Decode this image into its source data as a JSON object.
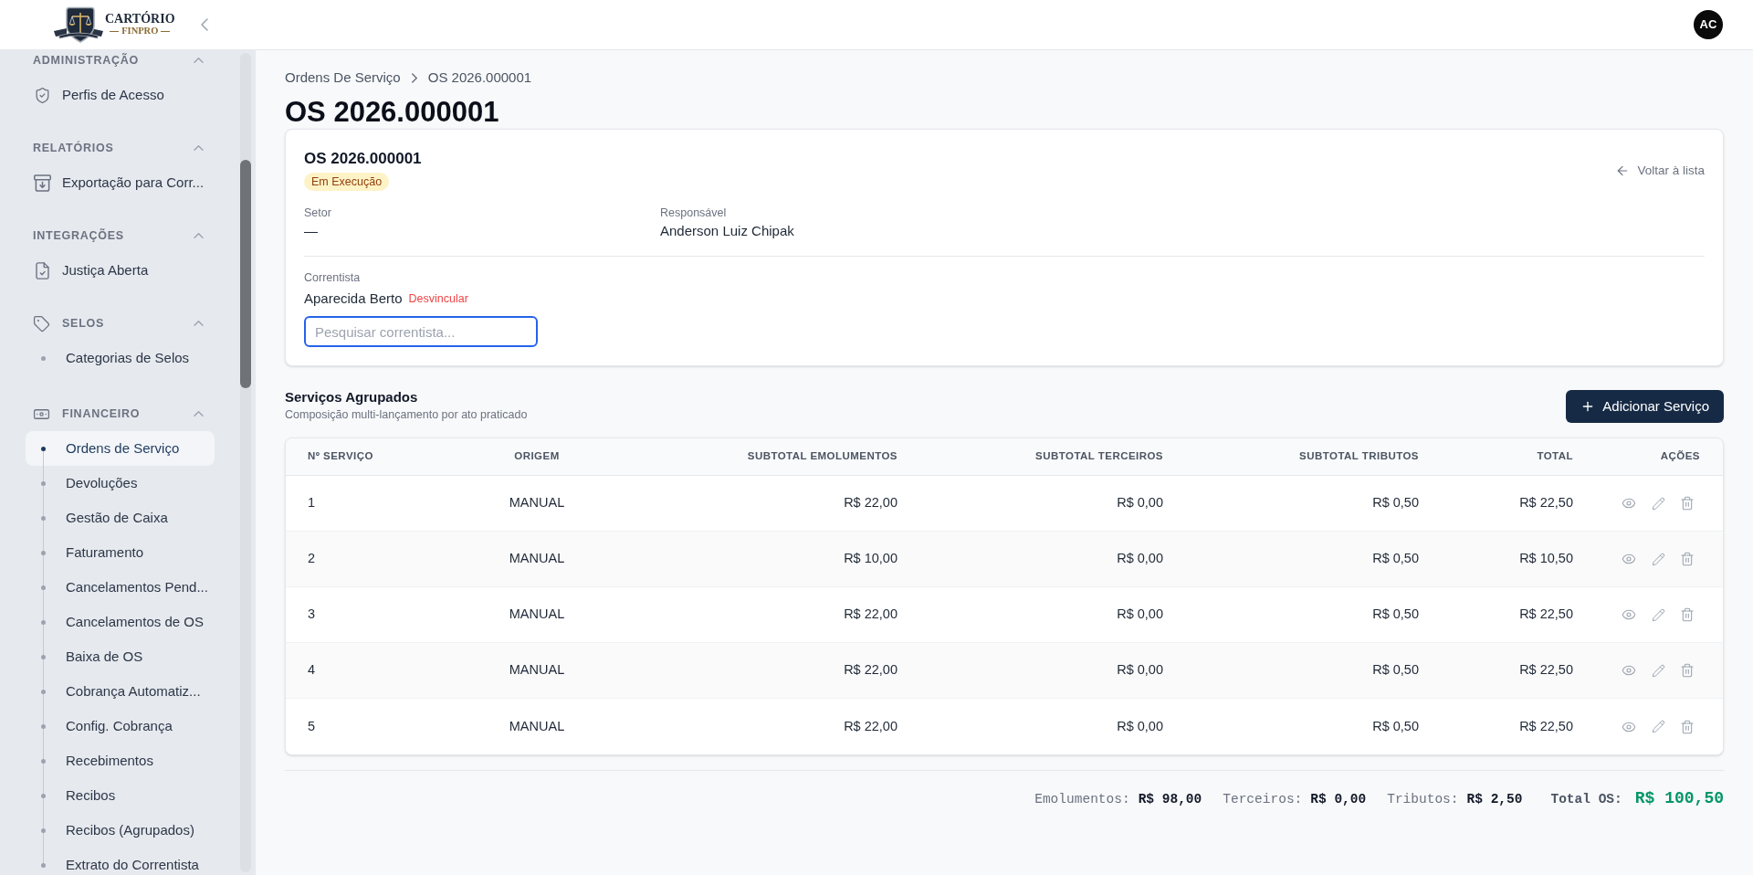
{
  "header": {
    "logo": {
      "name": "CARTÓRIO",
      "subname": "FINPRO"
    },
    "avatar_initials": "AC"
  },
  "sidebar": {
    "sections": [
      {
        "kind": "icon_items",
        "title": "ADMINISTRAÇÃO",
        "expanded": true,
        "items": [
          {
            "label": "Perfis de Acesso",
            "selected": false
          }
        ]
      },
      {
        "kind": "icon_items",
        "title": "RELATÓRIOS",
        "expanded": true,
        "items": [
          {
            "label": "Exportação para Corr...",
            "selected": false
          }
        ]
      },
      {
        "kind": "icon_items",
        "title": "INTEGRAÇÕES",
        "expanded": true,
        "items": [
          {
            "label": "Justiça Aberta",
            "selected": false
          }
        ]
      },
      {
        "kind": "dot_items",
        "title": "SELOS",
        "expanded": true,
        "items": [
          {
            "label": "Categorias de Selos",
            "selected": false
          }
        ]
      },
      {
        "kind": "dot_items",
        "title": "FINANCEIRO",
        "expanded": true,
        "items": [
          {
            "label": "Ordens de Serviço",
            "selected": true
          },
          {
            "label": "Devoluções",
            "selected": false
          },
          {
            "label": "Gestão de Caixa",
            "selected": false
          },
          {
            "label": "Faturamento",
            "selected": false
          },
          {
            "label": "Cancelamentos Pend...",
            "selected": false
          },
          {
            "label": "Cancelamentos de OS",
            "selected": false
          },
          {
            "label": "Baixa de OS",
            "selected": false
          },
          {
            "label": "Cobrança Automatiz...",
            "selected": false
          },
          {
            "label": "Config. Cobrança",
            "selected": false
          },
          {
            "label": "Recebimentos",
            "selected": false
          },
          {
            "label": "Recibos",
            "selected": false
          },
          {
            "label": "Recibos (Agrupados)",
            "selected": false
          },
          {
            "label": "Extrato do Correntista",
            "selected": false
          }
        ]
      }
    ]
  },
  "breadcrumb": [
    "Ordens De Serviço",
    "OS 2026.000001"
  ],
  "page_title": "OS 2026.000001",
  "order_card": {
    "title": "OS 2026.000001",
    "status": "Em Execução",
    "back_link": "Voltar à lista",
    "fields": [
      {
        "label": "Setor",
        "value": "—"
      },
      {
        "label": "Responsável",
        "value": "Anderson Luiz Chipak"
      }
    ],
    "correntista": {
      "label": "Correntista",
      "name": "Aparecida Berto",
      "unlink": "Desvincular",
      "search": {
        "placeholder": "Pesquisar correntista...",
        "focused": true
      }
    }
  },
  "services": {
    "title": "Serviços Agrupados",
    "subtitle": "Composição multi-lançamento por ato praticado",
    "add_button": "Adicionar Serviço",
    "table": {
      "columns": [
        "Nº SERVIÇO",
        "ORIGEM",
        "SUBTOTAL EMOLUMENTOS",
        "SUBTOTAL TERCEIROS",
        "SUBTOTAL TRIBUTOS",
        "TOTAL",
        "AÇÕES"
      ],
      "rows": [
        {
          "cells": [
            "1",
            "MANUAL",
            "R$ 22,00",
            "R$ 0,00",
            "R$ 0,50",
            "R$ 22,50"
          ]
        },
        {
          "cells": [
            "2",
            "MANUAL",
            "R$ 10,00",
            "R$ 0,00",
            "R$ 0,50",
            "R$ 10,50"
          ]
        },
        {
          "cells": [
            "3",
            "MANUAL",
            "R$ 22,00",
            "R$ 0,00",
            "R$ 0,50",
            "R$ 22,50"
          ]
        },
        {
          "cells": [
            "4",
            "MANUAL",
            "R$ 22,00",
            "R$ 0,00",
            "R$ 0,50",
            "R$ 22,50"
          ]
        },
        {
          "cells": [
            "5",
            "MANUAL",
            "R$ 22,00",
            "R$ 0,00",
            "R$ 0,50",
            "R$ 22,50"
          ]
        }
      ]
    }
  },
  "totals": [
    {
      "kind": "part",
      "label": "Emolumentos:",
      "value": "R$ 98,00"
    },
    {
      "kind": "part",
      "label": "Terceiros:",
      "value": "R$ 0,00"
    },
    {
      "kind": "part",
      "label": "Tributos:",
      "value": "R$ 2,50"
    },
    {
      "kind": "grand",
      "label": "Total OS:",
      "value": "R$ 100,50"
    }
  ]
}
